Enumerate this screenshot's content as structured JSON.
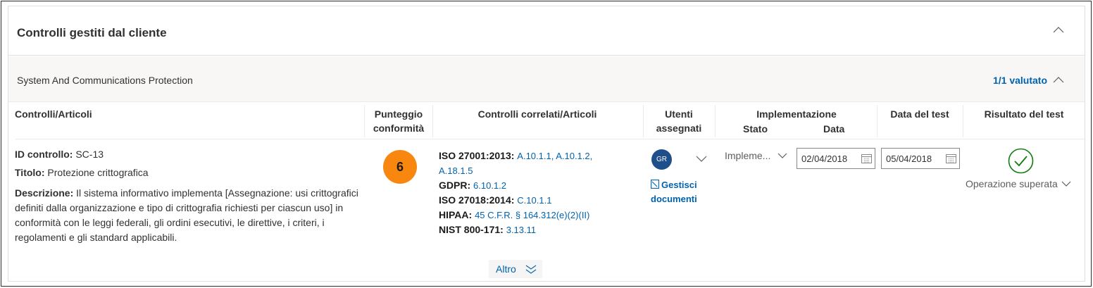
{
  "section": {
    "title": "Controlli gestiti dal cliente"
  },
  "group": {
    "title": "System And Communications Protection",
    "evaluated": "1/1 valutato"
  },
  "columns": {
    "controls": "Controlli/Articoli",
    "score_line1": "Punteggio",
    "score_line2": "conformità",
    "related": "Controlli correlati/Articoli",
    "users_line1": "Utenti",
    "users_line2": "assegnati",
    "implementation": "Implementazione",
    "impl_status": "Stato",
    "impl_date": "Data",
    "test_date": "Data del test",
    "test_result": "Risultato del test"
  },
  "row": {
    "id_label": "ID controllo:",
    "id_value": "SC-13",
    "title_label": "Titolo:",
    "title_value": "Protezione crittografica",
    "desc_label": "Descrizione:",
    "desc_value": "Il sistema informativo implementa [Assegnazione: usi crittografici definiti dalla organizzazione e tipo di crittografia richiesti per ciascun uso] in conformità con le leggi federali, gli ordini esecutivi, le direttive, i criteri, i regolamenti e gli standard applicabili.",
    "score": "6",
    "related": [
      {
        "key": "ISO 27001:2013:",
        "value": "A.10.1.1, A.10.1.2,"
      },
      {
        "key": "",
        "value": "A.18.1.5"
      },
      {
        "key": "GDPR:",
        "value": "6.10.1.2"
      },
      {
        "key": "ISO 27018:2014:",
        "value": "C.10.1.1"
      },
      {
        "key": "HIPAA:",
        "value": "45 C.F.R. § 164.312(e)(2)(II)"
      },
      {
        "key": "NIST 800-171:",
        "value": "3.13.11"
      }
    ],
    "assignee_initials": "GR",
    "manage_docs_line1": "Gestisci",
    "manage_docs_line2": "documenti",
    "status": "Impleme...",
    "impl_date": "02/04/2018",
    "test_date": "05/04/2018",
    "result": "Operazione superata"
  },
  "more_label": "Altro",
  "colors": {
    "accent": "#0062ad",
    "score_badge": "#f7870f",
    "pass_green": "#107c10",
    "avatar": "#1e4f8a"
  },
  "icons": [
    "chevron-up-icon",
    "chevron-down-icon",
    "calendar-icon",
    "document-icon",
    "check-circle-icon",
    "double-chevron-down-icon"
  ]
}
